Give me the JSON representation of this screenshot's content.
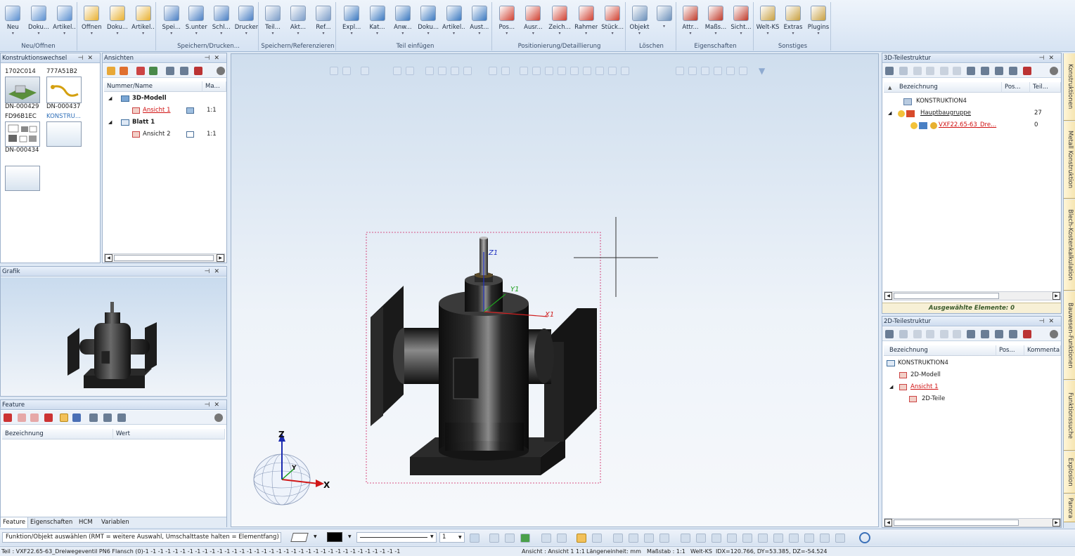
{
  "ribbon": {
    "groups": [
      {
        "label": "Neu/Öffnen",
        "buttons": [
          "Neu",
          "Doku...",
          "Artikel..."
        ]
      },
      {
        "label": "",
        "buttons": [
          "Öffnen",
          "Doku...",
          "Artikel..."
        ]
      },
      {
        "label": "Speichern/Drucken...",
        "buttons": [
          "Spei...",
          "S.unter",
          "Schl...",
          "Drucken"
        ]
      },
      {
        "label": "Speichern/Referenzieren",
        "buttons": [
          "Teil...",
          "Akt...",
          "Ref..."
        ]
      },
      {
        "label": "Teil einfügen",
        "buttons": [
          "Expl...",
          "Kat...",
          "Anw...",
          "Doku...",
          "Artikel...",
          "Aust..."
        ]
      },
      {
        "label": "Positionierung/Detaillierung",
        "buttons": [
          "Pos...",
          "Ausr...",
          "Zeich...",
          "Rahmen",
          "Stück..."
        ]
      },
      {
        "label": "Löschen",
        "buttons": [
          "Objekt",
          ""
        ]
      },
      {
        "label": "Eigenschaften",
        "buttons": [
          "Attr...",
          "Maßs...",
          "Sicht..."
        ]
      },
      {
        "label": "Sonstiges",
        "buttons": [
          "Welt-KS",
          "Extras",
          "Plugins"
        ]
      }
    ]
  },
  "konstruktionswechsel": {
    "title": "Konstruktionswechsel",
    "thumbs": [
      {
        "top": "1702C014",
        "bottom": "DN-000429"
      },
      {
        "top": "777A51B2",
        "bottom": "DN-000437"
      },
      {
        "top": "FD96B1EC",
        "bottom": "DN-000434"
      },
      {
        "top": "KONSTRU...",
        "bottom": ""
      },
      {
        "top": "",
        "bottom": ""
      }
    ]
  },
  "ansichten": {
    "title": "Ansichten",
    "col_name": "Nummer/Name",
    "col_scale": "Ma...",
    "rows": [
      {
        "name": "3D-Modell",
        "scale": ""
      },
      {
        "name": "Ansicht 1",
        "scale": "1:1"
      },
      {
        "name": "Blatt 1",
        "scale": ""
      },
      {
        "name": "Ansicht 2",
        "scale": "1:1"
      }
    ]
  },
  "grafik": {
    "title": "Grafik"
  },
  "feature": {
    "title": "Feature",
    "col_name": "Bezeichnung",
    "col_value": "Wert",
    "tabs": [
      "Feature",
      "Eigenschaften",
      "HCM",
      "Variablen"
    ]
  },
  "viewport": {
    "axes": {
      "z": "Z",
      "y": "Y",
      "x": "X",
      "z1": "Z1",
      "y1": "Y1",
      "x1": "X1"
    }
  },
  "teilestruktur3d": {
    "title": "3D-Teilestruktur",
    "col_name": "Bezeichnung",
    "col_pos": "Pos...",
    "col_part": "Teil...",
    "rows": [
      {
        "name": "KONSTRUKTION4",
        "pos": "",
        "part": ""
      },
      {
        "name": "Hauptbaugruppe",
        "pos": "",
        "part": "27"
      },
      {
        "name": "VXF22.65-63_Dre...",
        "pos": "",
        "part": "0"
      }
    ],
    "selected": "Ausgewählte Elemente: 0"
  },
  "teilestruktur2d": {
    "title": "2D-Teilestruktur",
    "col_name": "Bezeichnung",
    "col_pos": "Pos...",
    "col_comment": "Kommenta",
    "rows": [
      {
        "name": "KONSTRUKTION4"
      },
      {
        "name": "2D-Modell"
      },
      {
        "name": "Ansicht 1"
      },
      {
        "name": "2D-Teile"
      }
    ]
  },
  "sidetabs": [
    "Konstruktionen",
    "Metall Konstruktion",
    "Blech-Kostenkalkulation",
    "Bauwesen-Funktionen",
    "Funktionssuche",
    "Explosion",
    "Panora"
  ],
  "command": {
    "prompt": "Funktion/Objekt auswählen (RMT = weitere Auswahl, Umschalttaste halten = Elementfang)",
    "linewidth": "1"
  },
  "status": {
    "left": "Teil : VXF22.65-63_Dreiwegeventil PN6 Flansch (0)-1 -1 -1 -1 -1 -1 -1 -1 -1 -1 -1 -1 -1 -1 -1 -1 -1 -1 -1 -1 -1 -1 -1 -1 -1 -1 -1 -1 -1 -1 -1 -1 -1 -1 -1",
    "view": "Ansicht : Ansicht 1 1:1",
    "unit": "Längeneinheit: mm",
    "scale": "Maßstab : 1:1",
    "ks": "Welt-KS",
    "coords": "IDX=120.766, DY=53.385, DZ=-54.524"
  }
}
